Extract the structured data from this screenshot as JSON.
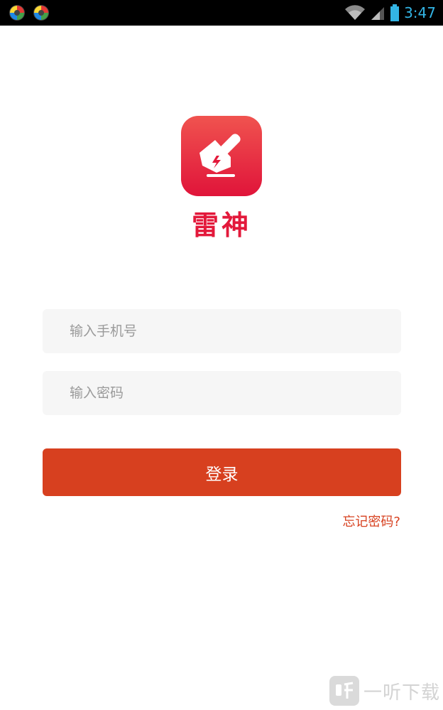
{
  "status_bar": {
    "time": "3:47",
    "icons": [
      "app-notification-icon",
      "app-notification-icon",
      "wifi-icon",
      "signal-icon",
      "battery-icon"
    ]
  },
  "app": {
    "name": "雷神"
  },
  "form": {
    "phone_placeholder": "输入手机号",
    "phone_value": "",
    "password_placeholder": "输入密码",
    "password_value": "",
    "login_label": "登录",
    "forgot_label": "忘记密码?"
  },
  "watermark": {
    "text": "一听下载"
  },
  "colors": {
    "accent": "#d7401f",
    "brand": "#e3193b",
    "input_bg": "#f6f6f6",
    "status_time": "#33b5e5"
  }
}
